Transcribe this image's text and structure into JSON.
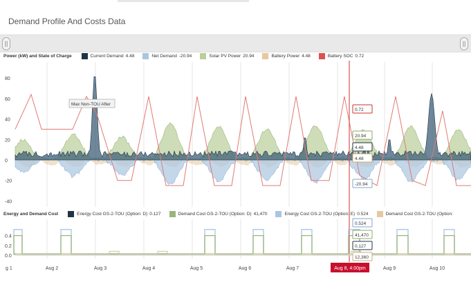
{
  "page": {
    "title": "Demand Profile And Costs Data"
  },
  "navigator": {
    "left_handle": "||",
    "right_handle": "||"
  },
  "chart_data": [
    {
      "type": "area",
      "title": "Power (kW) and State of Charge",
      "y_ticks": [
        "80",
        "60",
        "40",
        "20",
        "0",
        "-20",
        "-40"
      ],
      "ylim": [
        -40,
        90
      ],
      "legend": [
        {
          "name": "Current Demand",
          "value": "4.48",
          "color": "#1f3344"
        },
        {
          "name": "Net Demand",
          "value": "-20.94",
          "color": "#a9c6e0"
        },
        {
          "name": "Solar PV Power",
          "value": "20.94",
          "color": "#b9cf9a"
        },
        {
          "name": "Battery Power",
          "value": "4.48",
          "color": "#e6c9a0"
        },
        {
          "name": "Battery SOC",
          "value": "0.72",
          "color": "#d9534f"
        }
      ],
      "x_ticks": [
        "g 1",
        "Aug 2",
        "Aug 3",
        "Aug 4",
        "Aug 5",
        "Aug 6",
        "Aug 7",
        "Aug 9",
        "Aug 10"
      ],
      "solar_daily_peak_kW": [
        18,
        24,
        21,
        34,
        31,
        29,
        32,
        28,
        31,
        28,
        27
      ],
      "demand_spike_kW": 85,
      "demand_spike_2_kW": 65,
      "annotation": "Max Non-TOU After",
      "crosshair_labels": [
        {
          "text": "0.72",
          "color": "#c9302c"
        },
        {
          "text": "20.94",
          "color": "#8aa86a"
        },
        {
          "text": "4.48",
          "color": "#1f3344"
        },
        {
          "text": "4.48",
          "color": "#c9a878"
        },
        {
          "text": "-20.94",
          "color": "#7fa6cc"
        }
      ]
    },
    {
      "type": "line",
      "title": "Energy and Demand Cost",
      "y_ticks": [
        "0.4",
        "0.2",
        "0.0"
      ],
      "ylim": [
        0,
        0.55
      ],
      "legend": [
        {
          "name": "Energy Cost GS-2-TOU (Option: D)",
          "value": "0.127",
          "color": "#1f3344"
        },
        {
          "name": "Demand Cost GS-2-TOU (Option: D)",
          "value": "41,470",
          "color": "#9ab57a"
        },
        {
          "name": "Energy Cost GS-2-TOU (Option: E)",
          "value": "0.524",
          "color": "#a9c6e0"
        },
        {
          "name": "Demand Cost GS-2-TOU (Option:",
          "value": "",
          "color": "#e6c9a0"
        }
      ],
      "crosshair_labels": [
        {
          "text": "0.524",
          "color": "#7fa6cc"
        },
        {
          "text": "41,470",
          "color": "#8aa86a"
        },
        {
          "text": "0.127",
          "color": "#1f3344"
        },
        {
          "text": "12,360",
          "color": "#c9a878"
        }
      ],
      "option_e_peak": 0.524,
      "option_d_peak": 0.4,
      "option_d_base": 0.03,
      "option_e_base": 0.01
    }
  ],
  "crosshair_date": "Aug 8, 4:00pm"
}
